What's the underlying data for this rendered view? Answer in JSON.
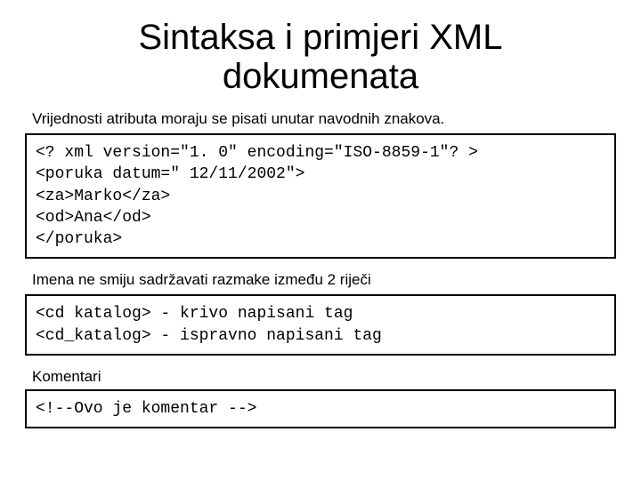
{
  "title": "Sintaksa i primjeri XML dokumenata",
  "section1": {
    "caption": "Vrijednosti atributa moraju se pisati unutar navodnih znakova.",
    "code": "<? xml version=\"1. 0\" encoding=\"ISO-8859-1\"? >\n<poruka datum=\" 12/11/2002\">\n<za>Marko</za>\n<od>Ana</od>\n</poruka>"
  },
  "section2": {
    "caption": "Imena ne smiju sadržavati razmake između 2 riječi",
    "code": "<cd katalog> - krivo napisani tag\n<cd_katalog> - ispravno napisani tag"
  },
  "section3": {
    "caption": "Komentari",
    "code": "<!--Ovo je komentar -->"
  }
}
